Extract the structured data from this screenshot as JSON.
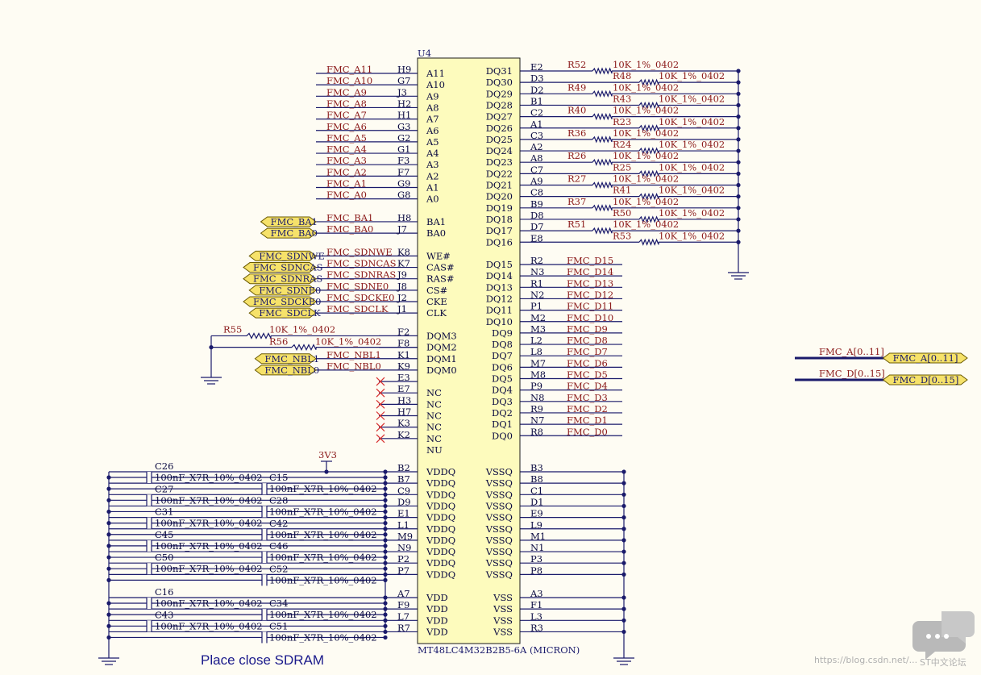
{
  "ic": {
    "ref": "U4",
    "part": "MT48LC4M32B2B5-6A",
    "maker": "(MICRON)",
    "left_pins": [
      {
        "name": "A11",
        "num": "H9",
        "net": "FMC_A11"
      },
      {
        "name": "A10",
        "num": "G7",
        "net": "FMC_A10"
      },
      {
        "name": "A9",
        "num": "J3",
        "net": "FMC_A9"
      },
      {
        "name": "A8",
        "num": "H2",
        "net": "FMC_A8"
      },
      {
        "name": "A7",
        "num": "H1",
        "net": "FMC_A7"
      },
      {
        "name": "A6",
        "num": "G3",
        "net": "FMC_A6"
      },
      {
        "name": "A5",
        "num": "G2",
        "net": "FMC_A5"
      },
      {
        "name": "A4",
        "num": "G1",
        "net": "FMC_A4"
      },
      {
        "name": "A3",
        "num": "F3",
        "net": "FMC_A3"
      },
      {
        "name": "A2",
        "num": "F7",
        "net": "FMC_A2"
      },
      {
        "name": "A1",
        "num": "G9",
        "net": "FMC_A1"
      },
      {
        "name": "A0",
        "num": "G8",
        "net": "FMC_A0"
      },
      {
        "name": "",
        "num": "",
        "net": ""
      },
      {
        "name": "BA1",
        "num": "H8",
        "net": "FMC_BA1",
        "port": "FMC_BA1"
      },
      {
        "name": "BA0",
        "num": "J7",
        "net": "FMC_BA0",
        "port": "FMC_BA0"
      },
      {
        "name": "",
        "num": "",
        "net": ""
      },
      {
        "name": "WE#",
        "num": "K8",
        "net": "FMC_SDNWE",
        "port": "FMC_SDNWE"
      },
      {
        "name": "CAS#",
        "num": "K7",
        "net": "FMC_SDNCAS",
        "port": "FMC_SDNCAS"
      },
      {
        "name": "RAS#",
        "num": "J9",
        "net": "FMC_SDNRAS",
        "port": "FMC_SDNRAS"
      },
      {
        "name": "CS#",
        "num": "J8",
        "net": "FMC_SDNE0",
        "port": "FMC_SDNE0"
      },
      {
        "name": "CKE",
        "num": "J2",
        "net": "FMC_SDCKE0",
        "port": "FMC_SDCKE0"
      },
      {
        "name": "CLK",
        "num": "J1",
        "net": "FMC_SDCLK",
        "port": "FMC_SDCLK"
      },
      {
        "name": "",
        "num": "",
        "net": ""
      },
      {
        "name": "DQM3",
        "num": "F2",
        "net": ""
      },
      {
        "name": "DQM2",
        "num": "F8",
        "net": ""
      },
      {
        "name": "DQM1",
        "num": "K1",
        "net": "FMC_NBL1",
        "port": "FMC_NBL1"
      },
      {
        "name": "DQM0",
        "num": "K9",
        "net": "FMC_NBL0",
        "port": "FMC_NBL0"
      },
      {
        "name": "",
        "num": "E3",
        "net": ""
      },
      {
        "name": "NC",
        "num": "E7",
        "net": "",
        "nc": true
      },
      {
        "name": "NC",
        "num": "H3",
        "net": "",
        "nc": true
      },
      {
        "name": "NC",
        "num": "H7",
        "net": "",
        "nc": true
      },
      {
        "name": "NC",
        "num": "K3",
        "net": "",
        "nc": true
      },
      {
        "name": "NC",
        "num": "K2",
        "net": "",
        "nc": true
      },
      {
        "name": "NU",
        "num": "",
        "net": ""
      }
    ],
    "dq_upper": [
      {
        "name": "DQ31",
        "num": "E2",
        "res": "R52",
        "val": "10K_1%_0402"
      },
      {
        "name": "DQ30",
        "num": "D3",
        "res": "R48",
        "val": "10K_1%_0402"
      },
      {
        "name": "DQ29",
        "num": "D2",
        "res": "R49",
        "val": "10K_1%_0402"
      },
      {
        "name": "DQ28",
        "num": "B1",
        "res": "R43",
        "val": "10K_1%_0402"
      },
      {
        "name": "DQ27",
        "num": "C2",
        "res": "R40",
        "val": "10K_1%_0402"
      },
      {
        "name": "DQ26",
        "num": "A1",
        "res": "R23",
        "val": "10K_1%_0402"
      },
      {
        "name": "DQ25",
        "num": "C3",
        "res": "R36",
        "val": "10K_1%_0402"
      },
      {
        "name": "DQ24",
        "num": "A2",
        "res": "R24",
        "val": "10K_1%_0402"
      },
      {
        "name": "DQ23",
        "num": "A8",
        "res": "R26",
        "val": "10K_1%_0402"
      },
      {
        "name": "DQ22",
        "num": "C7",
        "res": "R25",
        "val": "10K_1%_0402"
      },
      {
        "name": "DQ21",
        "num": "A9",
        "res": "R27",
        "val": "10K_1%_0402"
      },
      {
        "name": "DQ20",
        "num": "C8",
        "res": "R41",
        "val": "10K_1%_0402"
      },
      {
        "name": "DQ19",
        "num": "B9",
        "res": "R37",
        "val": "10K_1%_0402"
      },
      {
        "name": "DQ18",
        "num": "D8",
        "res": "R50",
        "val": "10K_1%_0402"
      },
      {
        "name": "DQ17",
        "num": "D7",
        "res": "R51",
        "val": "10K_1%_0402"
      },
      {
        "name": "DQ16",
        "num": "E8",
        "res": "R53",
        "val": "10K_1%_0402"
      }
    ],
    "dq_lower": [
      {
        "name": "DQ15",
        "num": "R2",
        "net": "FMC_D15"
      },
      {
        "name": "DQ14",
        "num": "N3",
        "net": "FMC_D14"
      },
      {
        "name": "DQ13",
        "num": "R1",
        "net": "FMC_D13"
      },
      {
        "name": "DQ12",
        "num": "N2",
        "net": "FMC_D12"
      },
      {
        "name": "DQ11",
        "num": "P1",
        "net": "FMC_D11"
      },
      {
        "name": "DQ10",
        "num": "M2",
        "net": "FMC_D10"
      },
      {
        "name": "DQ9",
        "num": "M3",
        "net": "FMC_D9"
      },
      {
        "name": "DQ8",
        "num": "L2",
        "net": "FMC_D8"
      },
      {
        "name": "DQ7",
        "num": "L8",
        "net": "FMC_D7"
      },
      {
        "name": "DQ6",
        "num": "M7",
        "net": "FMC_D6"
      },
      {
        "name": "DQ5",
        "num": "M8",
        "net": "FMC_D5"
      },
      {
        "name": "DQ4",
        "num": "P9",
        "net": "FMC_D4"
      },
      {
        "name": "DQ3",
        "num": "N8",
        "net": "FMC_D3"
      },
      {
        "name": "DQ2",
        "num": "R9",
        "net": "FMC_D2"
      },
      {
        "name": "DQ1",
        "num": "N7",
        "net": "FMC_D1"
      },
      {
        "name": "DQ0",
        "num": "R8",
        "net": "FMC_D0"
      }
    ],
    "vddq_pins": [
      "B2",
      "B7",
      "C9",
      "D9",
      "E1",
      "L1",
      "M9",
      "N9",
      "P2",
      "P7"
    ],
    "vssq_pins": [
      "B3",
      "B8",
      "C1",
      "D1",
      "E9",
      "L9",
      "M1",
      "N1",
      "P3",
      "P8"
    ],
    "vdd_pins": [
      "A7",
      "F9",
      "L7",
      "R7"
    ],
    "vss_pins": [
      "A3",
      "F1",
      "L3",
      "R3"
    ],
    "vddq_label": "VDDQ",
    "vssq_label": "VSSQ",
    "vdd_label": "VDD",
    "vss_label": "VSS"
  },
  "dqm_resistors": [
    {
      "ref": "R55",
      "val": "10K_1%_0402"
    },
    {
      "ref": "R56",
      "val": "10K_1%_0402"
    }
  ],
  "power_label": "3V3",
  "caps_left": [
    {
      "ref": "C26",
      "val": "100nF_X7R_10%_0402"
    },
    {
      "ref": "C27",
      "val": "100nF_X7R_10%_0402"
    },
    {
      "ref": "C31",
      "val": "100nF_X7R_10%_0402"
    },
    {
      "ref": "C45",
      "val": "100nF_X7R_10%_0402"
    },
    {
      "ref": "C50",
      "val": "100nF_X7R_10%_0402"
    },
    {
      "ref": "C16",
      "val": "100nF_X7R_10%_0402"
    },
    {
      "ref": "C43",
      "val": "100nF_X7R_10%_0402"
    }
  ],
  "caps_right": [
    {
      "ref": "C15",
      "val": "100nF_X7R_10%_0402"
    },
    {
      "ref": "C28",
      "val": "100nF_X7R_10%_0402"
    },
    {
      "ref": "C42",
      "val": "100nF_X7R_10%_0402"
    },
    {
      "ref": "C46",
      "val": "100nF_X7R_10%_0402"
    },
    {
      "ref": "C52",
      "val": "100nF_X7R_10%_0402"
    },
    {
      "ref": "C34",
      "val": "100nF_X7R_10%_0402"
    },
    {
      "ref": "C51",
      "val": "100nF_X7R_10%_0402"
    }
  ],
  "buses": [
    {
      "net": "FMC_A[0..11]",
      "port": "FMC_A[0..11]"
    },
    {
      "net": "FMC_D[0..15]",
      "port": "FMC_D[0..15]"
    }
  ],
  "note": "Place close SDRAM",
  "watermark": "https://blog.csdn.net/...",
  "forum_label": "ST中文论坛",
  "colors": {
    "wire": "#1a1a6b",
    "net": "#8b1a1a",
    "ic_fill": "#fdfbbd",
    "port_fill": "#f6e26a",
    "nc": "#d83030",
    "bg": "#fefcf3"
  }
}
